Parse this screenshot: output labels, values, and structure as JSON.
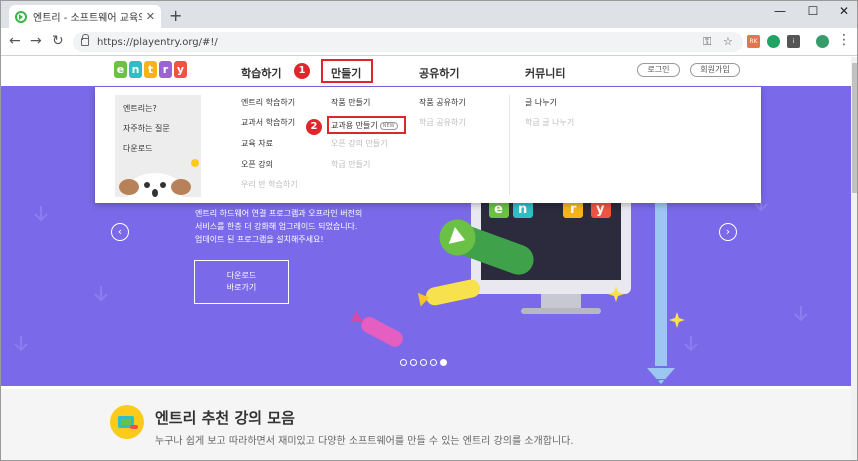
{
  "browser": {
    "tab_title": "엔트리 - 소프트웨어 교육의 첫 ",
    "url": "https://playentry.org/#!/",
    "win_min": "—",
    "win_max": "☐",
    "win_close": "✕"
  },
  "header": {
    "logo_letters": [
      "e",
      "n",
      "t",
      "r",
      "y"
    ],
    "logo_colors": [
      "#6bc146",
      "#2ebec4",
      "#f8b31c",
      "#9c62d8",
      "#ef5442"
    ],
    "menu": {
      "learn": "학습하기",
      "make": "만들기",
      "share": "공유하기",
      "community": "커뮤니티"
    },
    "login": "로그인",
    "signup": "회원가입",
    "badge1": "1",
    "badge2": "2"
  },
  "dropdown": {
    "about": [
      "엔트리는?",
      "자주하는 질문",
      "다운로드"
    ],
    "learn": [
      "엔트리 학습하기",
      "교과서 학습하기",
      "교육 자료",
      "오픈 강의",
      "우리 반 학습하기"
    ],
    "make": [
      "작품 만들기",
      "교과용 만들기",
      "오픈 강의 만들기",
      "학급 만들기"
    ],
    "make_new_tag": "NEW",
    "share": [
      "작품 공유하기",
      "학급 공유하기"
    ],
    "community": [
      "글 나누기",
      "학급 글 나누기"
    ]
  },
  "hero": {
    "text_lines": [
      "엔트리 하드웨어 연결 프로그램과 오프라인 버전의",
      "서비스를 한층 더 강화해 업그레이드 되었습니다.",
      "업데이트 된 프로그램을 설치해주세요!"
    ],
    "button_lines": [
      "다운로드",
      "바로가기"
    ],
    "slide_count": 5,
    "active_slide": 5
  },
  "section": {
    "title": "엔트리 추천 강의 모음",
    "desc": "누구나 쉽게 보고 따라하면서 재미있고 다양한 소프트웨어를 만들 수 있는 엔트리 강의를 소개합니다."
  },
  "colors": {
    "hero_bg": "#7a69e8",
    "highlight": "#e0262d",
    "accent_yellow": "#fbcb1b"
  }
}
